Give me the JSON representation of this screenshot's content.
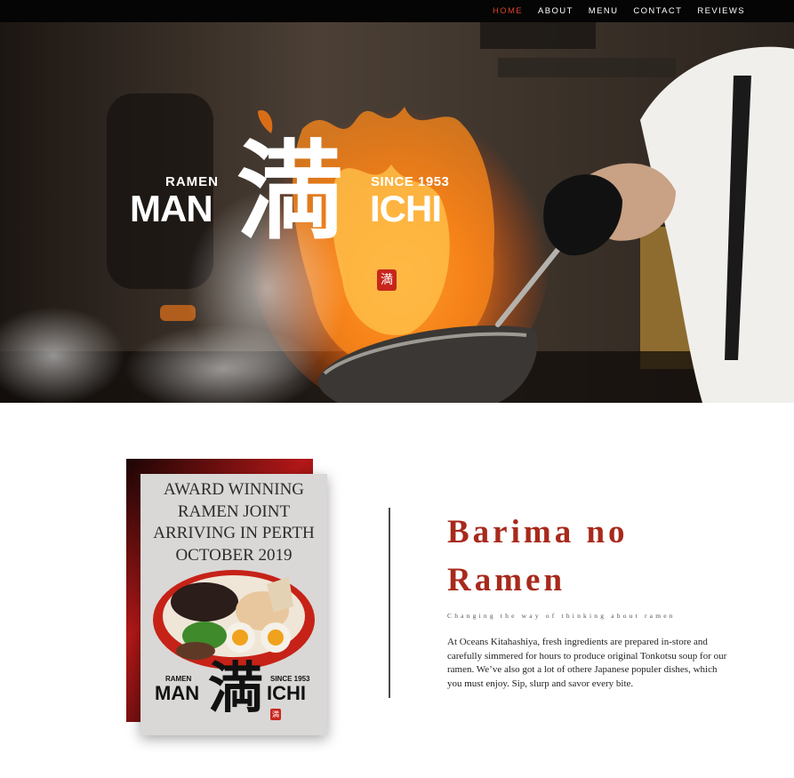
{
  "nav": {
    "items": [
      {
        "label": "HOME",
        "active": true
      },
      {
        "label": "ABOUT",
        "active": false
      },
      {
        "label": "MENU",
        "active": false
      },
      {
        "label": "CONTACT",
        "active": false
      },
      {
        "label": "REVIEWS",
        "active": false
      }
    ],
    "active_color": "#d8432e"
  },
  "hero": {
    "logo": {
      "ramen": "RAMEN",
      "since": "SINCE 1953",
      "man": "MAN",
      "ichi": "ICHI",
      "kanji": "満",
      "seal": "満"
    }
  },
  "poster": {
    "title_lines": [
      "AWARD WINNING",
      "RAMEN JOINT",
      "ARRIVING IN PERTH",
      "OCTOBER 2019"
    ],
    "logo": {
      "ramen": "RAMEN",
      "since": "SINCE 1953",
      "man": "MAN",
      "ichi": "ICHI",
      "kanji": "満",
      "seal": "満"
    }
  },
  "content": {
    "headline": "Barima no Ramen",
    "tagline": "Changing the way of thinking about ramen",
    "body": "At Oceans Kitahashiya, fresh ingredients are prepared in-store and carefully simmered for hours to produce original Tonkotsu soup for our ramen. We’ve also got a lot of othere Japanese populer dishes, which you must enjoy. Sip, slurp and savor every bite."
  },
  "colors": {
    "accent": "#a82a1c",
    "topbar": "#050505"
  }
}
